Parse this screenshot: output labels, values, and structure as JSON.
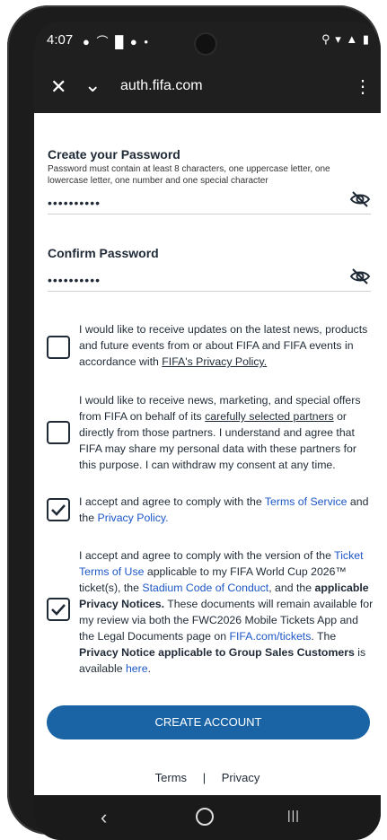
{
  "status": {
    "time": "4:07",
    "left_icons": "● ⌒ █ ● •",
    "right_icons": "⚲ ▾ ▲ ▮"
  },
  "browser": {
    "url": "auth.fifa.com"
  },
  "password": {
    "label": "Create your Password",
    "hint": "Password must contain at least 8 characters, one uppercase letter, one lowercase letter, one number and one special character",
    "value": "••••••••••"
  },
  "confirm": {
    "label": "Confirm Password",
    "value": "••••••••••"
  },
  "consents": {
    "c1": {
      "checked": false,
      "text": "I would like to receive updates on the latest news, products and future events from or about FIFA and FIFA events in accordance with ",
      "link": "FIFA's Privacy Policy."
    },
    "c2": {
      "checked": false,
      "text_a": "I would like to receive news, marketing, and special offers from FIFA on behalf of its ",
      "link": "carefully selected partners",
      "text_b": " or directly from those partners. I understand and agree that FIFA may share my personal data with these partners for this purpose. I can withdraw my consent at any time."
    },
    "c3": {
      "checked": true,
      "text_a": "I accept and agree to comply with the ",
      "link_terms": "Terms of Service",
      "text_b": " and the ",
      "link_privacy": "Privacy Policy."
    },
    "c4": {
      "checked": true,
      "text_a": "I accept and agree to comply with the version of the ",
      "link_ticket": "Ticket Terms of Use",
      "text_b": " applicable to my FIFA World Cup 2026™ ticket(s), the ",
      "link_stadium": "Stadium Code of Conduct",
      "text_c": ", and the ",
      "bold_applicable": "applicable Privacy Notices.",
      "text_d": " These documents will remain available for my review via both the FWC2026 Mobile Tickets App and the Legal Documents page on ",
      "link_fifa": "FIFA.com/tickets",
      "text_e": ". The ",
      "bold_privacy": "Privacy Notice applicable to Group Sales Customers",
      "text_f": " is available ",
      "link_here": "here",
      "text_g": "."
    }
  },
  "button": {
    "label": "CREATE ACCOUNT"
  },
  "footer": {
    "terms": "Terms",
    "separator": "|",
    "privacy": "Privacy"
  },
  "colors": {
    "primary": "#1a64a6",
    "link": "#1c57c7",
    "text": "#1f2a36"
  }
}
